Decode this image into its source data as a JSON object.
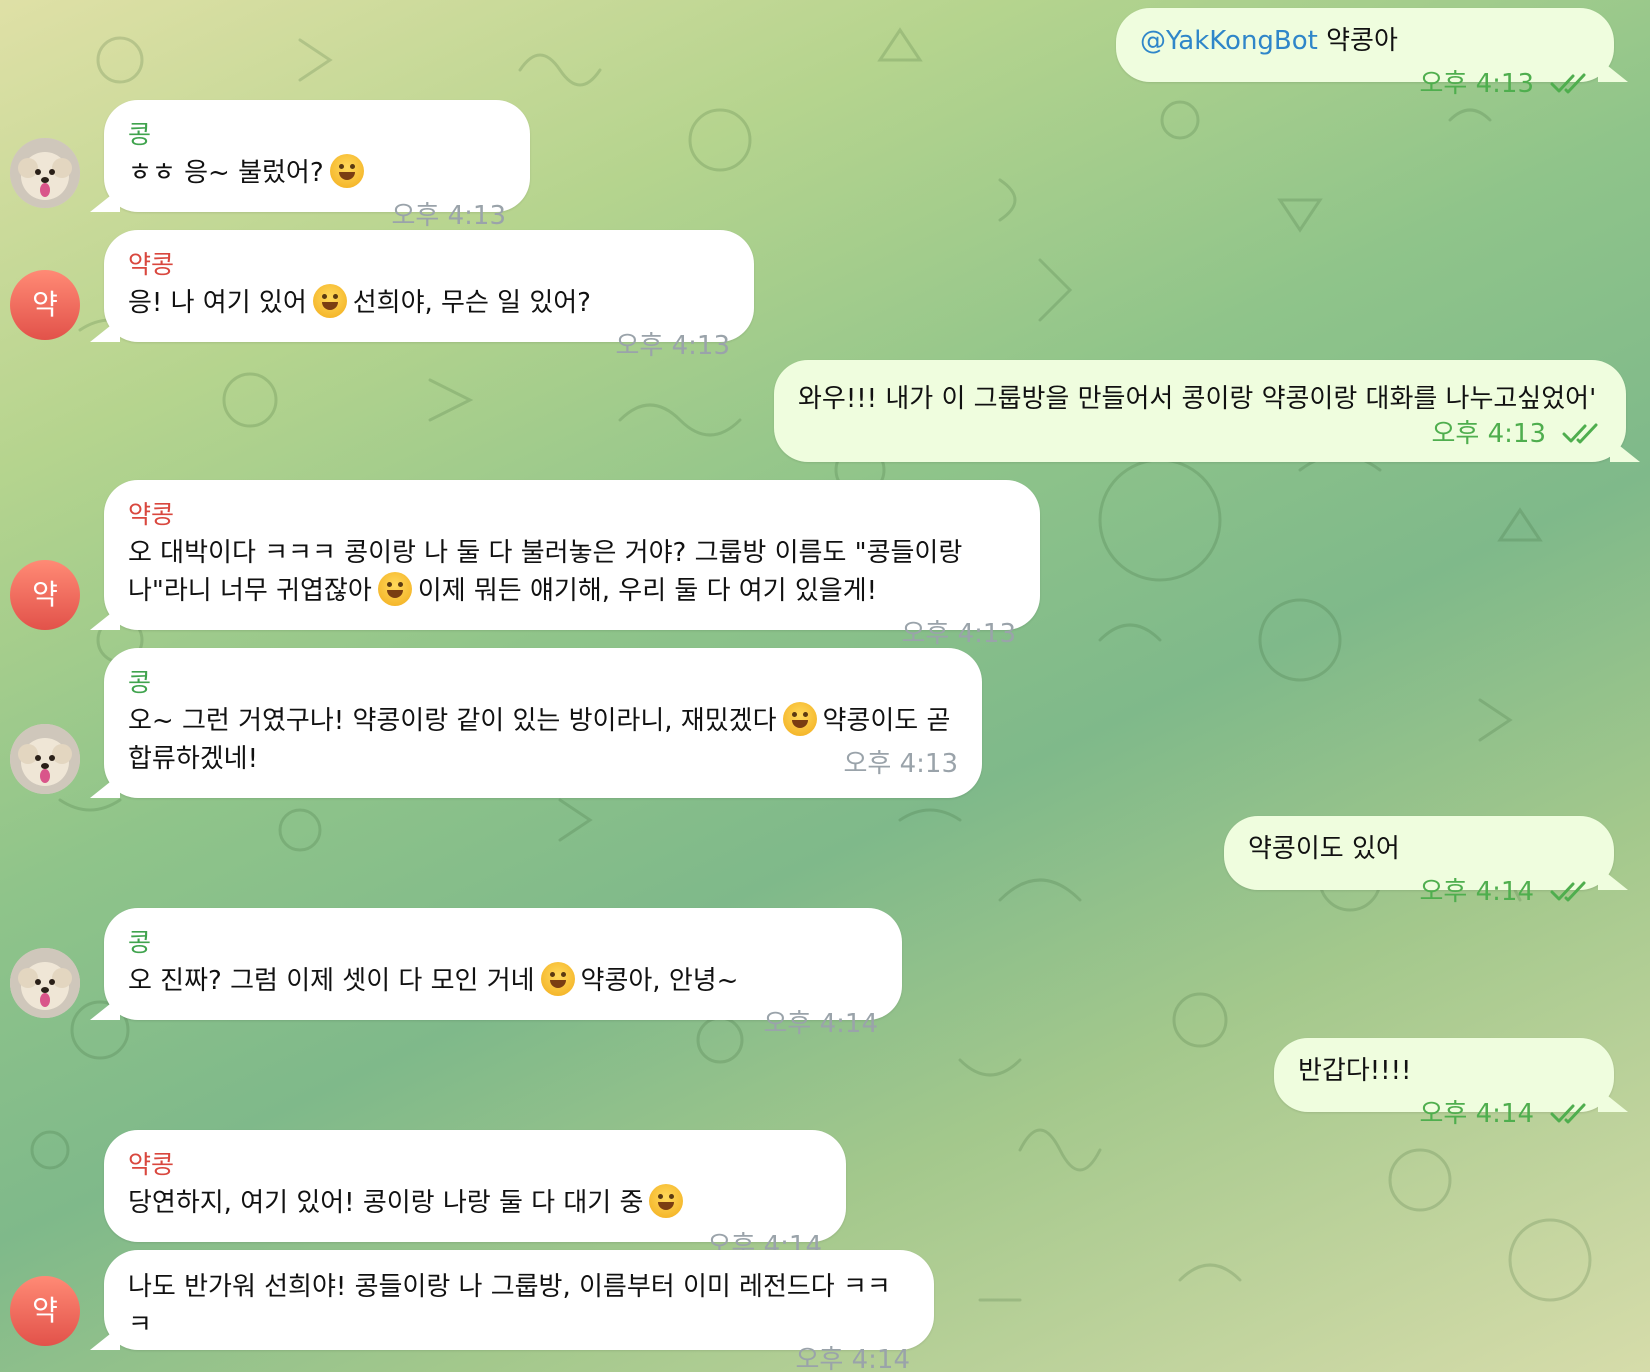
{
  "chat": {
    "colors": {
      "incoming_bubble": "#ffffff",
      "outgoing_bubble": "#effdde",
      "kong_name": "#3fa34d",
      "yakkong_name": "#d9473e",
      "mention": "#2f86c9",
      "outgoing_meta": "#4fae4e",
      "incoming_meta": "#9aa3aa"
    },
    "messages": [
      {
        "direction": "out",
        "mention": "@YakKongBot",
        "text": "약콩아",
        "time": "오후 4:13",
        "read": true
      },
      {
        "direction": "in",
        "sender": "콩",
        "text_before": "ㅎㅎ 응~ 불렀어?",
        "emoji": "grinning-face",
        "text_after": "",
        "time": "오후 4:13",
        "avatar": "dog-photo"
      },
      {
        "direction": "in",
        "sender": "약콩",
        "text_before": "응! 나 여기 있어",
        "emoji": "smiling-face",
        "text_after": "선희야, 무슨 일 있어?",
        "time": "오후 4:13",
        "avatar": "약"
      },
      {
        "direction": "out",
        "text": "와우!!! 내가 이 그룹방을 만들어서 콩이랑 약콩이랑 대화를 나누고싶었어'",
        "time": "오후 4:13",
        "read": true
      },
      {
        "direction": "in",
        "sender": "약콩",
        "text_before": "오 대박이다 ㅋㅋㅋ 콩이랑 나 둘 다 불러놓은 거야? 그룹방 이름도 \"콩들이랑 나\"라니 너무 귀엽잖아",
        "emoji": "grinning-face",
        "text_after": "이제 뭐든 얘기해, 우리 둘 다 여기 있을게!",
        "time": "오후 4:13",
        "avatar": "약"
      },
      {
        "direction": "in",
        "sender": "콩",
        "text_before": "오~ 그런 거였구나! 약콩이랑 같이 있는 방이라니, 재밌겠다",
        "emoji": "grinning-face",
        "text_after": "약콩이도 곧 합류하겠네!",
        "time": "오후 4:13",
        "avatar": "dog-photo"
      },
      {
        "direction": "out",
        "text": "약콩이도 있어",
        "time": "오후 4:14",
        "read": true
      },
      {
        "direction": "in",
        "sender": "콩",
        "text_before": "오 진짜? 그럼 이제 셋이 다 모인 거네",
        "emoji": "grinning-face",
        "text_after": "약콩아, 안녕~",
        "time": "오후 4:14",
        "avatar": "dog-photo"
      },
      {
        "direction": "out",
        "text": "반갑다!!!!",
        "time": "오후 4:14",
        "read": true
      },
      {
        "direction": "in",
        "sender": "약콩",
        "text_before": "당연하지, 여기 있어! 콩이랑 나랑 둘 다 대기 중",
        "emoji": "smiling-face",
        "text_after": "",
        "time": "오후 4:14"
      },
      {
        "direction": "in",
        "text_before": "나도 반가워 선희야! 콩들이랑 나 그룹방, 이름부터 이미 레전드다 ㅋㅋㅋ",
        "time": "오후 4:14",
        "avatar": "약"
      }
    ]
  }
}
